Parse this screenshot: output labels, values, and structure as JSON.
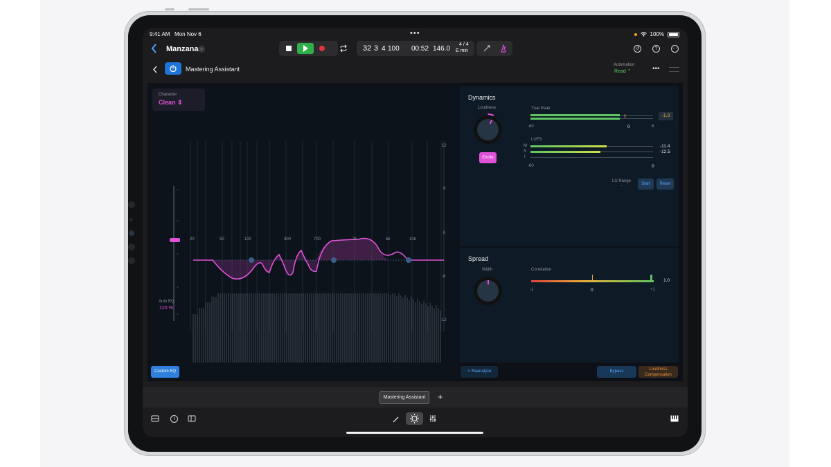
{
  "status_bar": {
    "time": "9:41 AM",
    "date": "Mon Nov 6",
    "battery": "100%"
  },
  "toolbar": {
    "project": "Manzana",
    "bars": "32",
    "beats": "3",
    "div": "4",
    "ticks": "100",
    "time": "00:52",
    "tempo": "146.0",
    "signature": "4 / 4",
    "key": "E min"
  },
  "plugin": {
    "name": "Mastering Assistant",
    "automation_label": "Automation",
    "automation_value": "Read"
  },
  "eq": {
    "character_label": "Character",
    "character_value": "Clean",
    "auto_eq_label": "Auto EQ",
    "auto_eq_value": "120 %",
    "custom_eq": "Custom EQ",
    "freq_labels": [
      "20",
      "50",
      "100",
      "300",
      "700",
      "2k",
      "5k",
      "10k"
    ],
    "db_labels": [
      "12",
      "6",
      "0",
      "-6",
      "-12"
    ]
  },
  "dynamics": {
    "title": "Dynamics",
    "loudness_label": "Loudness",
    "excite": "Excite",
    "true_peak_label": "True Peak",
    "true_peak_value": "-1.0",
    "true_peak_ticks": [
      "-60",
      "0",
      "6"
    ],
    "true_peak_level": 0.73,
    "lufs_label": "LUFS",
    "lufs_m_label": "M",
    "lufs_m_value": "-11.4",
    "lufs_s_label": "S",
    "lufs_s_value": "-12.5",
    "lufs_i_label": "I",
    "lufs_ticks": [
      "-60",
      "0"
    ],
    "lu_range_label": "LU Range",
    "lu_range_value": "-",
    "start": "Start",
    "reset": "Reset"
  },
  "spread": {
    "title": "Spread",
    "width_label": "Width",
    "correlation_label": "Correlation",
    "correlation_value": "1.0",
    "ticks": [
      "-1",
      "0",
      "+1"
    ]
  },
  "footer": {
    "reanalyze": "Reanalyze",
    "bypass": "Bypass",
    "loudness_comp_1": "Loudness",
    "loudness_comp_2": "Compensation"
  },
  "plugin_tabs": {
    "active": "Mastering Assistant",
    "add": "+"
  },
  "colors": {
    "accent_pink": "#e052d8",
    "accent_blue": "#2f7fdc",
    "play_green": "#30b04a",
    "record_red": "#e0343c",
    "automation_green": "#5ec462"
  }
}
